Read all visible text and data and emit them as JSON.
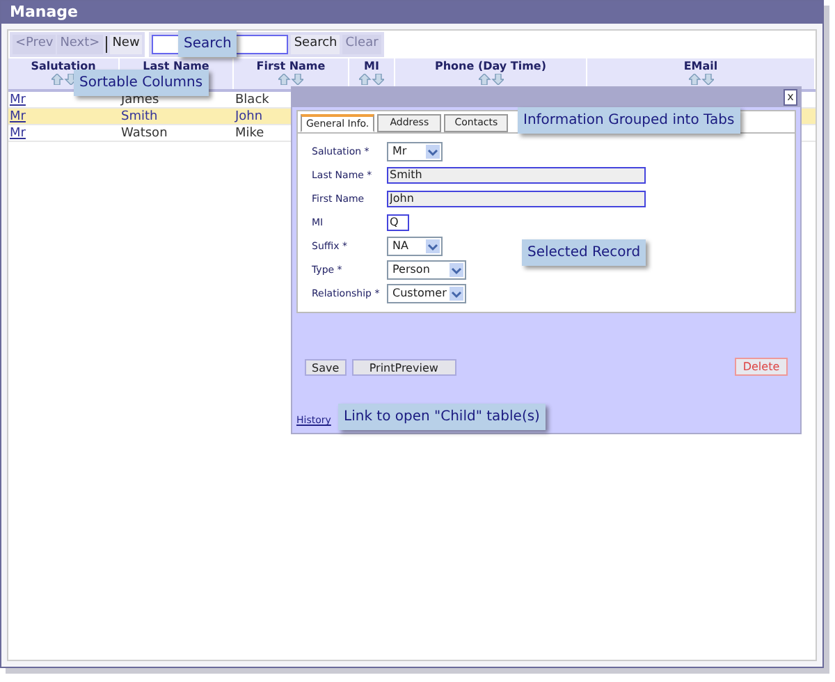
{
  "window": {
    "title": "Manage"
  },
  "toolbar": {
    "prev": {
      "label": "<Prev",
      "disabled": true
    },
    "next": {
      "label": "Next>",
      "disabled": true
    },
    "new": {
      "label": "New",
      "disabled": false
    },
    "search_button": {
      "label": "Search",
      "disabled": false
    },
    "clear": {
      "label": "Clear",
      "disabled": true
    }
  },
  "table": {
    "columns": [
      "Salutation",
      "Last Name",
      "First Name",
      "MI",
      "Phone (Day Time)",
      "EMail"
    ],
    "rows": [
      {
        "cells": [
          "Mr",
          "James",
          "Black"
        ],
        "selected": false
      },
      {
        "cells": [
          "Mr",
          "Smith",
          "John"
        ],
        "selected": true
      },
      {
        "cells": [
          "Mr",
          "Watson",
          "Mike"
        ],
        "selected": false
      }
    ]
  },
  "dialog": {
    "close": "x",
    "tabs": [
      {
        "label": "General Info.",
        "selected": true
      },
      {
        "label": "Address",
        "selected": false
      },
      {
        "label": "Contacts",
        "selected": false
      }
    ],
    "fields": [
      {
        "label": "Salutation *",
        "kind": "select",
        "value": "Mr"
      },
      {
        "label": "Last Name *",
        "kind": "text",
        "value": "Smith"
      },
      {
        "label": "First Name",
        "kind": "text",
        "value": "John"
      },
      {
        "label": "MI",
        "kind": "text",
        "value": "Q"
      },
      {
        "label": "Suffix *",
        "kind": "select",
        "value": "NA"
      },
      {
        "label": "Type *",
        "kind": "select",
        "value": "Person"
      },
      {
        "label": "Relationship *",
        "kind": "select",
        "value": "Customer"
      }
    ],
    "buttons": [
      "Save",
      "PrintPreview"
    ],
    "delete": "Delete",
    "link": "History"
  },
  "callouts": [
    "Search",
    "Sortable Columns",
    "Information Grouped into Tabs",
    "Selected Record",
    "Link to open \"Child\" table(s)"
  ]
}
